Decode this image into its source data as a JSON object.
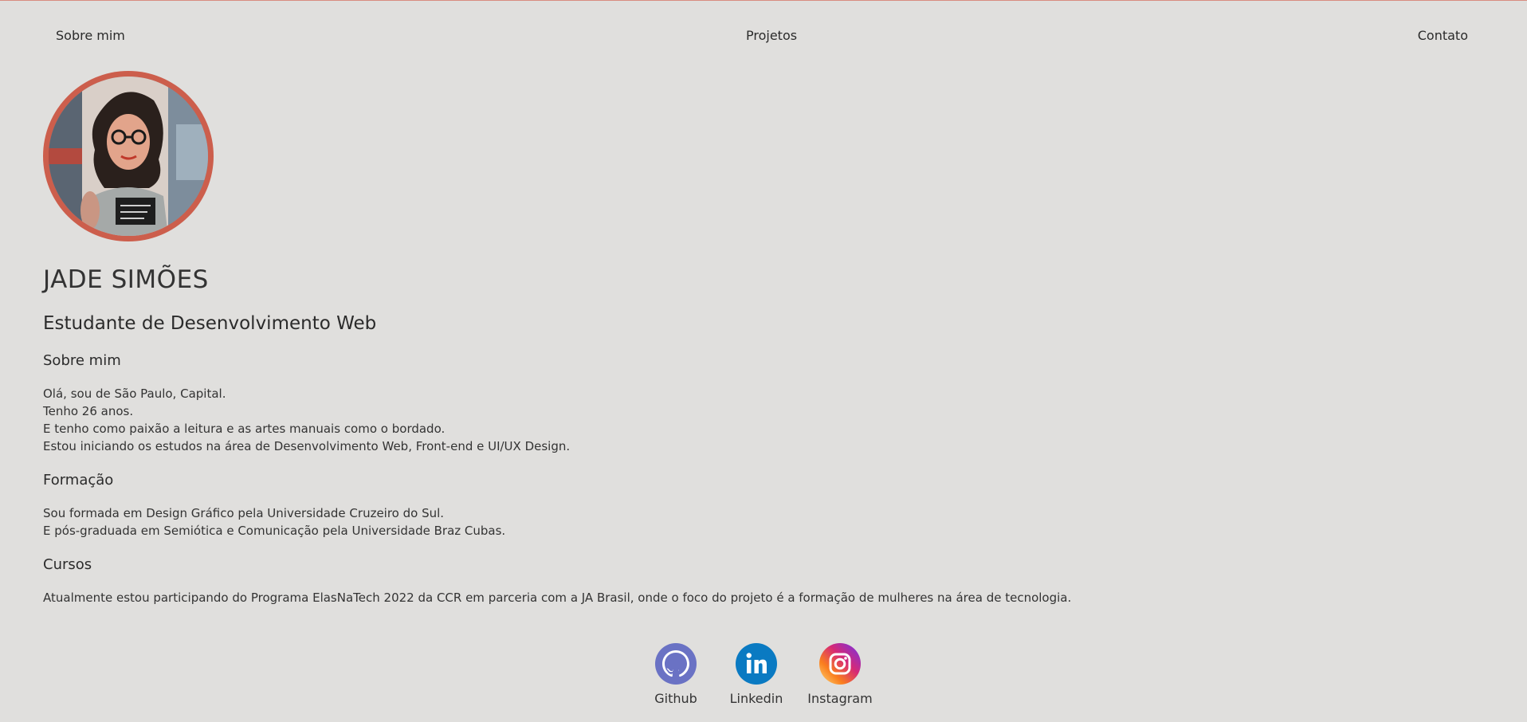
{
  "nav": {
    "about": "Sobre mim",
    "projects": "Projetos",
    "contact": "Contato"
  },
  "profile": {
    "name": "JADE SIMÕES",
    "role": "Estudante de Desenvolvimento Web"
  },
  "about": {
    "title": "Sobre mim",
    "lines": [
      "Olá, sou de São Paulo, Capital.",
      "Tenho 26 anos.",
      "E tenho como paixão a leitura e as artes manuais como o bordado.",
      "Estou iniciando os estudos na área de Desenvolvimento Web, Front-end e UI/UX Design."
    ]
  },
  "education": {
    "title": "Formação",
    "lines": [
      "Sou formada em Design Gráfico pela Universidade Cruzeiro do Sul.",
      "E pós-graduada em Semiótica e Comunicação pela Universidade Braz Cubas."
    ]
  },
  "courses": {
    "title": "Cursos",
    "lines": [
      "Atualmente estou participando do Programa ElasNaTech 2022 da CCR em parceria com a JA Brasil, onde o foco do projeto é a formação de mulheres na área de tecnologia."
    ]
  },
  "socials": {
    "github": {
      "label": "Github",
      "icon": "github-icon",
      "color": "#6a72c4"
    },
    "linkedin": {
      "label": "Linkedin",
      "icon": "linkedin-icon",
      "color": "#0a7ac2"
    },
    "instagram": {
      "label": "Instagram",
      "icon": "instagram-icon",
      "color": "#d6249f"
    }
  },
  "colors": {
    "background": "#e0dfdd",
    "avatar_border": "#cc5e4c",
    "text": "#2e2e2e"
  }
}
